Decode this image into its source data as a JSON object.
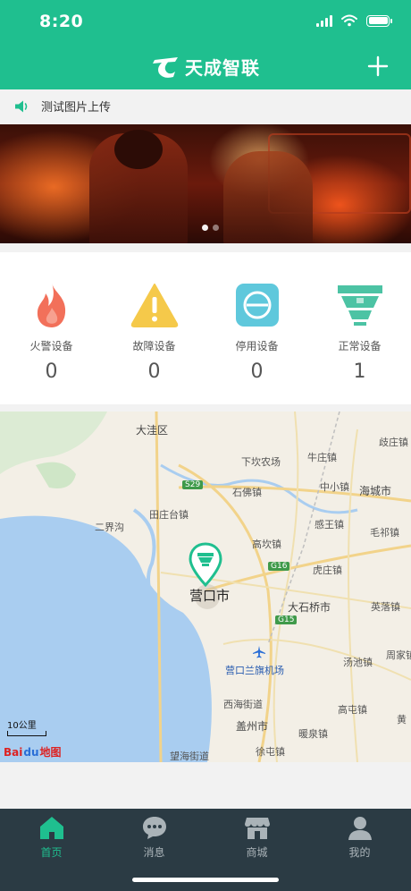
{
  "status_bar": {
    "time": "8:20"
  },
  "header": {
    "title": "天成智联",
    "add_icon": "plus-icon",
    "logo_icon": "brand-logo-icon"
  },
  "notice": {
    "icon": "speaker-icon",
    "text": "测试图片上传"
  },
  "banner": {
    "slides": 2,
    "active_slide": 1
  },
  "stats": [
    {
      "label": "火警设备",
      "value": "0",
      "icon": "fire-icon",
      "color": "#f2705a"
    },
    {
      "label": "故障设备",
      "value": "0",
      "icon": "warning-icon",
      "color": "#f5c94a"
    },
    {
      "label": "停用设备",
      "value": "0",
      "icon": "disabled-icon",
      "color": "#5fc8dc"
    },
    {
      "label": "正常设备",
      "value": "1",
      "icon": "smoke-detector-icon",
      "color": "#4cc3a4"
    }
  ],
  "map": {
    "labels": [
      "大洼区",
      "歧庄镇",
      "下坎农场",
      "牛庄镇",
      "S29",
      "石佛镇",
      "中小镇",
      "海城市",
      "田庄台镇",
      "二界沟",
      "感王镇",
      "毛祁镇",
      "高坎镇",
      "G16",
      "虎庄镇",
      "营口市",
      "大石桥市",
      "英落镇",
      "G15",
      "汤池镇",
      "周家镇",
      "营口兰旗机场",
      "西海街道",
      "高屯镇",
      "盖州市",
      "暖泉镇",
      "徐屯镇",
      "望海街道",
      "黄"
    ],
    "scale": "10公里",
    "attribution": {
      "a": "Bai",
      "b": "du",
      "c": "地图"
    },
    "marker_icon": "device-location-pin-icon"
  },
  "tabs": [
    {
      "label": "首页",
      "icon": "home-icon",
      "active": true
    },
    {
      "label": "消息",
      "icon": "chat-icon",
      "active": false
    },
    {
      "label": "商城",
      "icon": "shop-icon",
      "active": false
    },
    {
      "label": "我的",
      "icon": "user-icon",
      "active": false
    }
  ],
  "colors": {
    "primary": "#1fbf8f",
    "tabbar": "#2b3b44"
  }
}
